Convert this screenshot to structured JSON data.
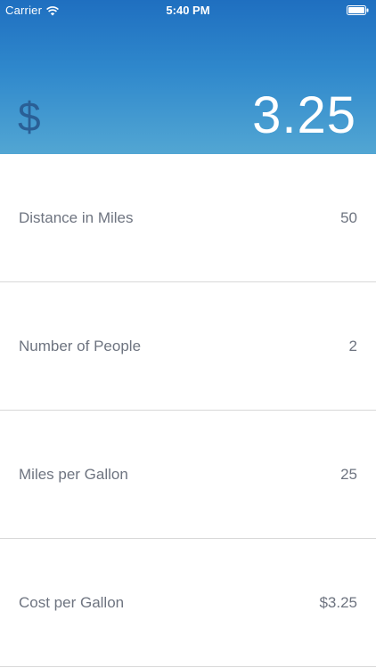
{
  "status_bar": {
    "carrier": "Carrier",
    "time": "5:40 PM"
  },
  "header": {
    "currency_symbol": "$",
    "total": "3.25"
  },
  "fields": [
    {
      "label": "Distance in Miles",
      "value": "50"
    },
    {
      "label": "Number of People",
      "value": "2"
    },
    {
      "label": "Miles per Gallon",
      "value": "25"
    },
    {
      "label": "Cost per Gallon",
      "value": "$3.25"
    }
  ],
  "icons": {
    "wifi": "wifi-icon",
    "battery": "battery-icon"
  },
  "colors": {
    "header_top": "#1f6fc0",
    "header_bottom": "#52a6d3",
    "currency_symbol": "#2a5f96",
    "label_text": "#6e7480",
    "divider": "#d8d8d8"
  }
}
